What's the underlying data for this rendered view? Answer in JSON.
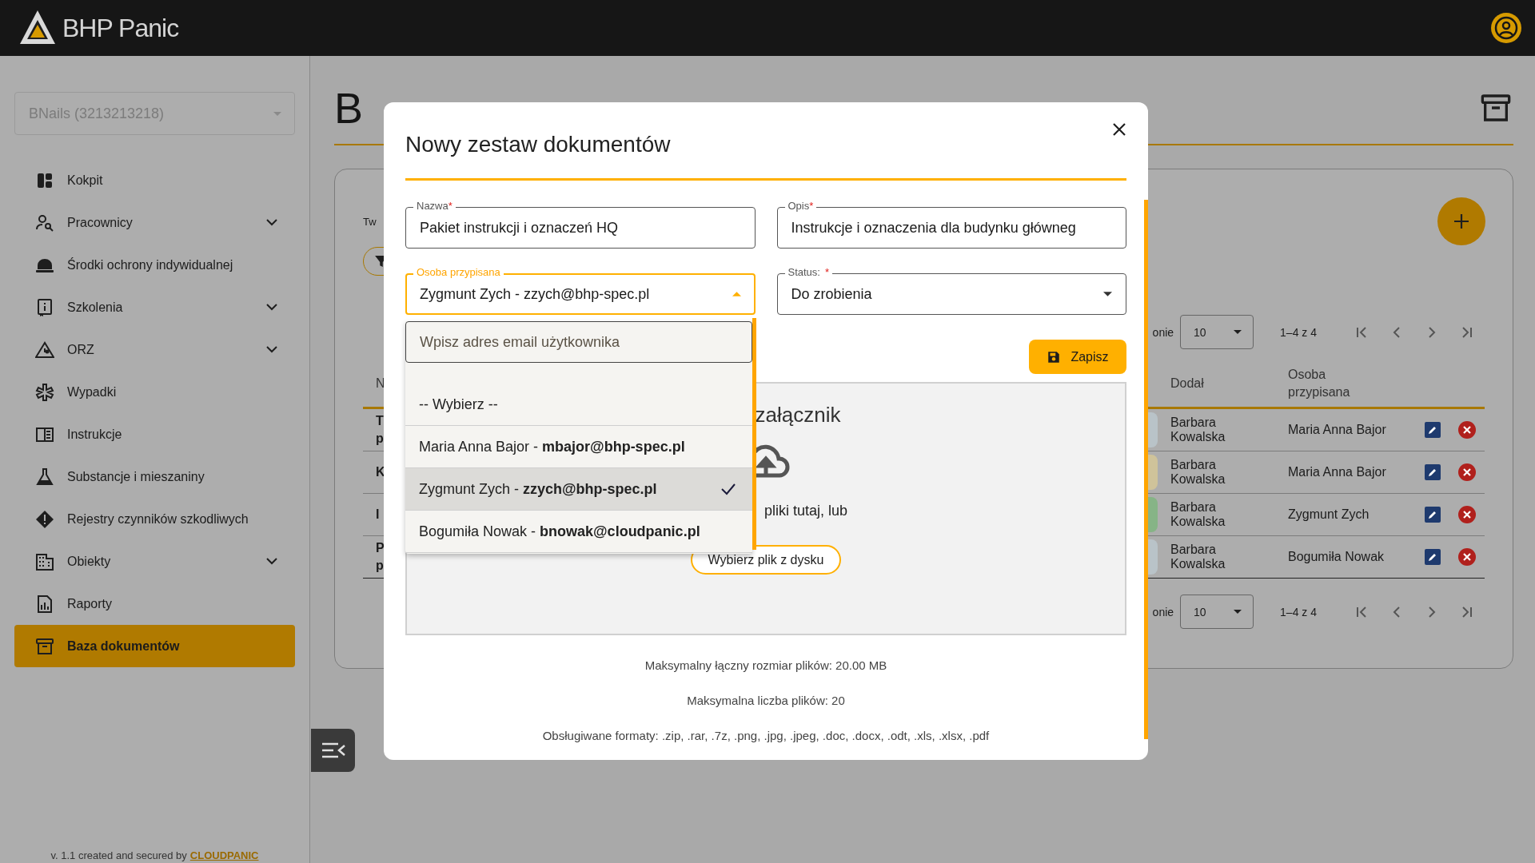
{
  "app": {
    "name": "BHP Panic"
  },
  "sidebar": {
    "company_select": "BNails (3213213218)",
    "items": [
      {
        "label": "Kokpit",
        "expandable": false,
        "selected": false
      },
      {
        "label": "Pracownicy",
        "expandable": true,
        "selected": false
      },
      {
        "label": "Środki ochrony indywidualnej",
        "expandable": false,
        "selected": false
      },
      {
        "label": "Szkolenia",
        "expandable": true,
        "selected": false
      },
      {
        "label": "ORZ",
        "expandable": true,
        "selected": false
      },
      {
        "label": "Wypadki",
        "expandable": false,
        "selected": false
      },
      {
        "label": "Instrukcje",
        "expandable": false,
        "selected": false
      },
      {
        "label": "Substancje i mieszaniny",
        "expandable": false,
        "selected": false
      },
      {
        "label": "Rejestry czynników szkodliwych",
        "expandable": false,
        "selected": false
      },
      {
        "label": "Obiekty",
        "expandable": true,
        "selected": false
      },
      {
        "label": "Raporty",
        "expandable": false,
        "selected": false
      },
      {
        "label": "Baza dokumentów",
        "expandable": false,
        "selected": true
      }
    ],
    "footer": {
      "text": "v. 1.1 created and secured by",
      "link": "CLOUDPANIC"
    }
  },
  "page": {
    "title": "B",
    "card_text": "Tw",
    "pagination": [
      {
        "rows_label": "onie",
        "rows_per_page": "10",
        "range": "1–4 z 4"
      },
      {
        "rows_label": "onie",
        "rows_per_page": "10",
        "range": "1–4 z 4"
      }
    ],
    "table": {
      "columns": [
        "N",
        "Dodał",
        "Osoba przypisana"
      ],
      "rows": [
        {
          "column_1": [
            "T",
            "p"
          ],
          "color": "#b9c3c8",
          "added_by": "Barbara Kowalska",
          "assigned": "Maria Anna Bajor"
        },
        {
          "column_1": [
            "K"
          ],
          "color": "#cfc39a",
          "added_by": "Barbara Kowalska",
          "assigned": "Maria Anna Bajor"
        },
        {
          "column_1": [
            "I"
          ],
          "color": "#86b486",
          "added_by": "Barbara Kowalska",
          "assigned": "Zygmunt Zych"
        },
        {
          "column_1": [
            "P",
            "p"
          ],
          "color": "#b9c3c8",
          "added_by": "Barbara Kowalska",
          "assigned": "Bogumiła Nowak"
        }
      ]
    }
  },
  "modal": {
    "title": "Nowy zestaw dokumentów",
    "fields": [
      {
        "kind": "text",
        "label": "Nazwa",
        "required_mark": "*",
        "focused": false,
        "value": "Pakiet instrukcji i oznaczeń HQ"
      },
      {
        "kind": "text",
        "label": "Opis",
        "required_mark": "*",
        "focused": false,
        "value": "Instrukcje i oznaczenia dla budynku główneg"
      },
      {
        "kind": "select",
        "label": "Osoba przypisana",
        "focused": true,
        "value": "Zygmunt Zych - zzych@bhp-spec.pl"
      },
      {
        "kind": "select",
        "label": "Status:",
        "required_mark": "*",
        "focused": false,
        "value": "Do zrobienia"
      }
    ],
    "dropdown": {
      "search_placeholder": "Wpisz adres email użytkownika",
      "options": [
        {
          "label": "-- Wybierz --",
          "selected": false
        },
        {
          "label": "Maria Anna Bajor - **mbajor@bhp-spec.pl**",
          "selected": false
        },
        {
          "label": "Zygmunt Zych - **zzych@bhp-spec.pl**",
          "selected": true
        },
        {
          "label": "Bogumiła Nowak - **bnowak@cloudpanic.pl**",
          "selected": false
        }
      ]
    },
    "save_button": "Zapisz",
    "dropzone": {
      "title": "załącznik",
      "hint": "pliki tutaj, lub",
      "button": "Wybierz plik z dysku"
    },
    "notes": [
      "Maksymalny łączny rozmiar plików: 20.00 MB",
      "Maksymalna liczba plików: 20",
      "Obsługiwane formaty: .zip, .rar, .7z, .png, .jpg, .jpeg, .doc, .docx, .odt, .xls, .xlsx, .pdf"
    ]
  }
}
